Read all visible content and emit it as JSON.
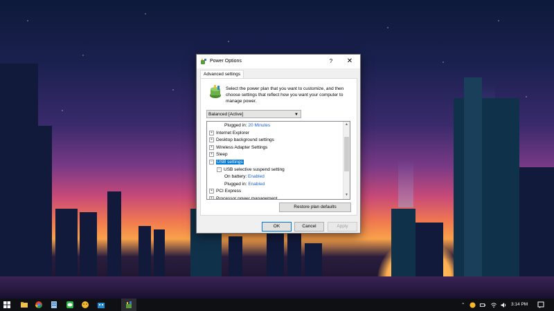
{
  "dialog": {
    "title": "Power Options",
    "help_glyph": "?",
    "close_glyph": "✕",
    "tab_label": "Advanced settings",
    "description": "Select the power plan that you want to customize, and then choose settings that reflect how you want your computer to manage power.",
    "plan_select_value": "Balanced [Active]",
    "tree": [
      {
        "indent": 2,
        "expander": "",
        "label": "Plugged in:",
        "value": "20 Minutes"
      },
      {
        "indent": 0,
        "expander": "+",
        "label": "Internet Explorer"
      },
      {
        "indent": 0,
        "expander": "+",
        "label": "Desktop background settings"
      },
      {
        "indent": 0,
        "expander": "+",
        "label": "Wireless Adapter Settings"
      },
      {
        "indent": 0,
        "expander": "+",
        "label": "Sleep"
      },
      {
        "indent": 0,
        "expander": "−",
        "label": "USB settings",
        "selected": true
      },
      {
        "indent": 1,
        "expander": "−",
        "label": "USB selective suspend setting"
      },
      {
        "indent": 2,
        "expander": "",
        "label": "On battery:",
        "value": "Enabled"
      },
      {
        "indent": 2,
        "expander": "",
        "label": "Plugged in:",
        "value": "Enabled"
      },
      {
        "indent": 0,
        "expander": "+",
        "label": "PCI Express"
      },
      {
        "indent": 0,
        "expander": "+",
        "label": "Processor power management"
      }
    ],
    "restore_label": "Restore plan defaults",
    "ok_label": "OK",
    "cancel_label": "Cancel",
    "apply_label": "Apply"
  },
  "taskbar": {
    "icons": [
      "windows-start-icon",
      "file-explorer-icon",
      "chrome-icon",
      "notepad-icon",
      "line-app-icon",
      "emoji-app-icon",
      "store-icon",
      "power-options-icon"
    ],
    "clock": "3:14 PM",
    "tray_icons": [
      "chevron-up-icon",
      "emoji-tray-icon",
      "power-plug-icon",
      "wifi-icon",
      "volume-icon",
      "notification-icon"
    ]
  },
  "colors": {
    "accent": "#0078d7",
    "link_value": "#1a5fd6",
    "taskbar": "#0f1014"
  }
}
